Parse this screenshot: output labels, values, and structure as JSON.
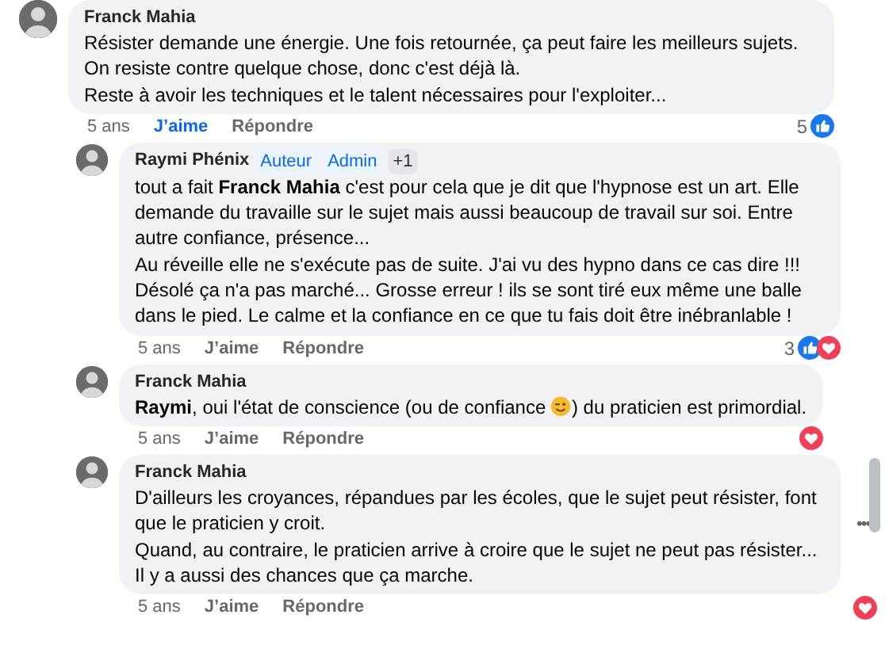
{
  "comments": [
    {
      "author": "Franck Mahia",
      "text": [
        "Résister demande une énergie. Une fois retournée, ça peut faire les meilleurs sujets. On resiste contre quelque chose, donc c'est déjà là.\nReste à avoir les techniques et le talent nécessaires pour l'exploiter..."
      ],
      "time": "5 ans",
      "like_label": "J’aime",
      "liked": true,
      "reply_label": "Répondre",
      "reactions": {
        "count": "5",
        "like": true,
        "love": false
      },
      "children": [
        {
          "author": "Raymi Phénix",
          "badges": [
            {
              "label": "Auteur",
              "kind": "role"
            },
            {
              "label": "Admin",
              "kind": "role"
            },
            {
              "label": "+1",
              "kind": "more"
            }
          ],
          "text": [
            "tout a fait **Franck Mahia** c'est pour cela que je dit que l'hypnose est un art. Elle demande du travaille sur le sujet mais aussi beaucoup de travail sur soi. Entre autre confiance, présence...\nAu réveille elle ne s'exécute pas de suite. J'ai vu des hypno dans ce cas dire !!! Désolé ça n'a pas marché... Grosse erreur ! ils se sont tiré eux même une balle dans le pied. Le calme et la confiance en ce que tu fais doit être inébranlable !"
          ],
          "time": "5 ans",
          "like_label": "J’aime",
          "liked": false,
          "reply_label": "Répondre",
          "reactions": {
            "count": "3",
            "like": true,
            "love": true
          }
        },
        {
          "author": "Franck Mahia",
          "text": [
            "**Raymi**, oui l'état de conscience (ou de confiance ",
            ") du praticien est primordial."
          ],
          "time": "5 ans",
          "like_label": "J’aime",
          "liked": false,
          "reply_label": "Répondre",
          "reactions": {
            "like": false,
            "love": true
          }
        },
        {
          "author": "Franck Mahia",
          "text": [
            "D'ailleurs les croyances, répandues par les écoles, que le sujet peut résister, font que le praticien y croit.\nQuand, au contraire, le praticien arrive à croire que le sujet ne peut pas résister... Il y a aussi des chances que ça marche."
          ],
          "time": "5 ans",
          "like_label": "J’aime",
          "liked": false,
          "reply_label": "Répondre",
          "reactions": {
            "like": false,
            "love": true
          },
          "more_button": "•••"
        }
      ]
    }
  ]
}
